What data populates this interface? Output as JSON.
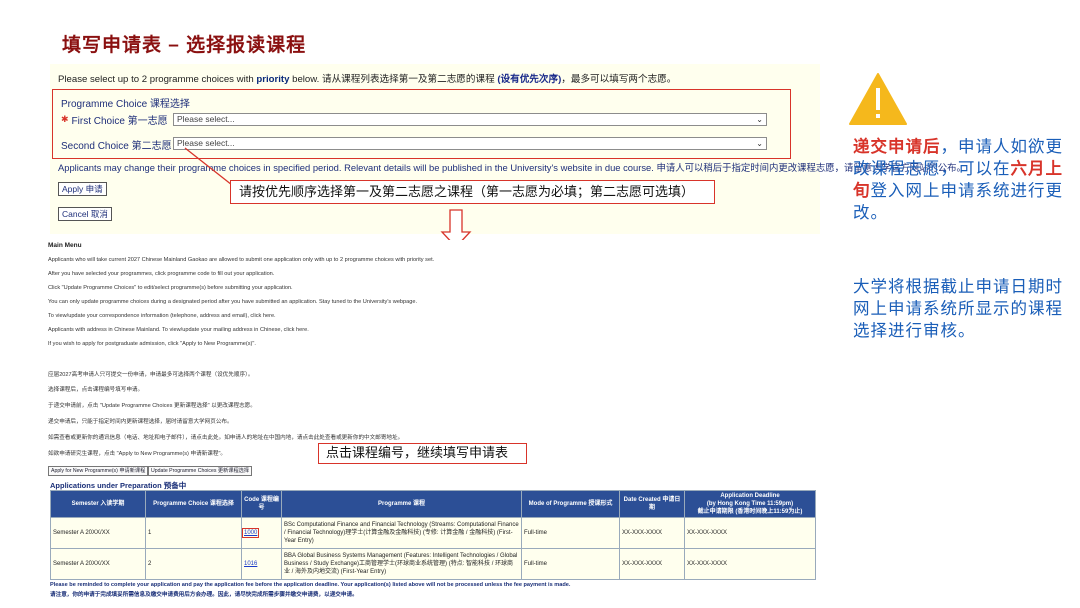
{
  "slide": {
    "title": "填写申请表 – 选择报读课程"
  },
  "form": {
    "intro_prefix": "Please select up to 2 programme choices with ",
    "intro_bold": "priority",
    "intro_mid": " below. 请从课程列表选择第一及第二志愿的课程 ",
    "intro_cn_bold": "(设有优先次序)",
    "intro_suffix": "，最多可以填写两个志愿。",
    "choice_header": "Programme Choice 课程选择",
    "required_mark": "✱",
    "first_label": "First Choice 第一志愿",
    "first_placeholder": "Please select...",
    "second_label": "Second Choice 第二志愿",
    "second_placeholder": "Please select...",
    "change_note": "Applicants may change their programme choices in specified period. Relevant details will be published in the University's website in due course. 申请人可以稍后于指定时间内更改课程志愿，请留意大学官方网站的公布。",
    "apply_button": "Apply 申请",
    "cancel_button": "Cancel 取消"
  },
  "callouts": {
    "priority": "请按优先顺序选择第一及第二志愿之课程（第一志愿为必填；第二志愿可选填）",
    "click_code": "点击课程编号，继续填写申请表"
  },
  "main_menu": {
    "title": "Main Menu",
    "lines": [
      "Applicants who will take current 2027 Chinese Mainland Gaokao are allowed to submit one application only with up to 2 programme choices with priority set.",
      "After you have selected your programmes, click programme code to fill out your application.",
      "Click \"Update Programme Choices\" to edit/select programme(s) before submitting your application.",
      "You can only update programme choices during a designated period after you have submitted an application. Stay tuned to the University's webpage.",
      "To view/update your correspondence information (telephone, address and email), click here.",
      "Applicants with address in Chinese Mainland. To view/update your mailing address in Chinese, click here.",
      "If you wish to apply for postgraduate admission, click \"Apply to New Programme(s)\"."
    ],
    "cn_lines": [
      "应届2027高考申请人只可提交一份申请，申请最多可选择两个课程（设优先顺序）。",
      "选择课程后，点击课程编号填写申请。",
      "于递交申请前，点击 \"Update Programme Choices 更新课程选择\" 以更改课程志愿。",
      "递交申请后，只能于指定时间内更新课程选择，届时请留意大学网页公布。",
      "如需查看或更新你的通讯信息（电话、地址和电子邮件），请点击此处。如申请人的地址在中国内地，请点击此处查看或更新你的中文邮寄地址。",
      "如欲申请研究生课程，点击 \"Apply to New Programme(s) 申请新课程\"。"
    ],
    "btn_new": "Apply for New Programme(s) 申请新课程",
    "btn_update": "Update Programme Choices 更新课程选择"
  },
  "apps": {
    "title": "Applications under Preparation 预备中",
    "headers": {
      "semester": "Semester 入读学期",
      "choice": "Programme Choice 课程选择",
      "code": "Code 课程编号",
      "programme": "Programme 课程",
      "mode": "Mode of Programme 授课形式",
      "created": "Date Created 申请日期",
      "deadline_1": "Application Deadline",
      "deadline_2": "(by Hong Kong Time 11:59pm)",
      "deadline_3": "截止申请期限 (香港时间晚上11:59为止)"
    },
    "rows": [
      {
        "semester": "Semester A 20XX/XX",
        "choice": "1",
        "code": "1000",
        "programme": "BSc Computational Finance and Financial Technology (Streams: Computational Finance / Financial Technology)理学士(计算金融及金融科技) (专修: 计算金融 / 金融科技) (First-Year Entry)",
        "mode": "Full-time",
        "created": "XX-XXX-XXXX",
        "deadline": "XX-XXX-XXXX"
      },
      {
        "semester": "Semester A 20XX/XX",
        "choice": "2",
        "code": "1016",
        "programme": "BBA Global Business Systems Management (Features: Intelligent Technologies / Global Business / Study Exchange)工商管理学士(环球商业系统管理) (特点: 智能科技 / 环球商业 / 海外及内地交流) (First-Year Entry)",
        "mode": "Full-time",
        "created": "XX-XXX-XXXX",
        "deadline": "XX-XXX-XXXX"
      }
    ],
    "reminder_en": "Please be reminded to complete your application and pay the application fee before the application deadline. Your application(s) listed above will not be processed unless the fee payment is made.",
    "reminder_cn": "请注意，你的申请于完成填妥所需信息及缴交申请费用后方会办理。因此，请尽快完成所需步骤并缴交申请费，以递交申请。"
  },
  "side": {
    "note1_red1": "递交申请后",
    "note1_a": "，申请人如欲更改课程志愿，可以在",
    "note1_red2": "六月上旬",
    "note1_b": "登入网上申请系统进行更改。",
    "note2": "大学将根据截止申请日期时网上申请系统所显示的课程选择进行审核。"
  },
  "colors": {
    "title": "#8a1010",
    "accent_red": "#d8342a",
    "side_blue": "#1a5eb8",
    "table_header": "#2c4f96",
    "warning": "#f5b81c"
  }
}
